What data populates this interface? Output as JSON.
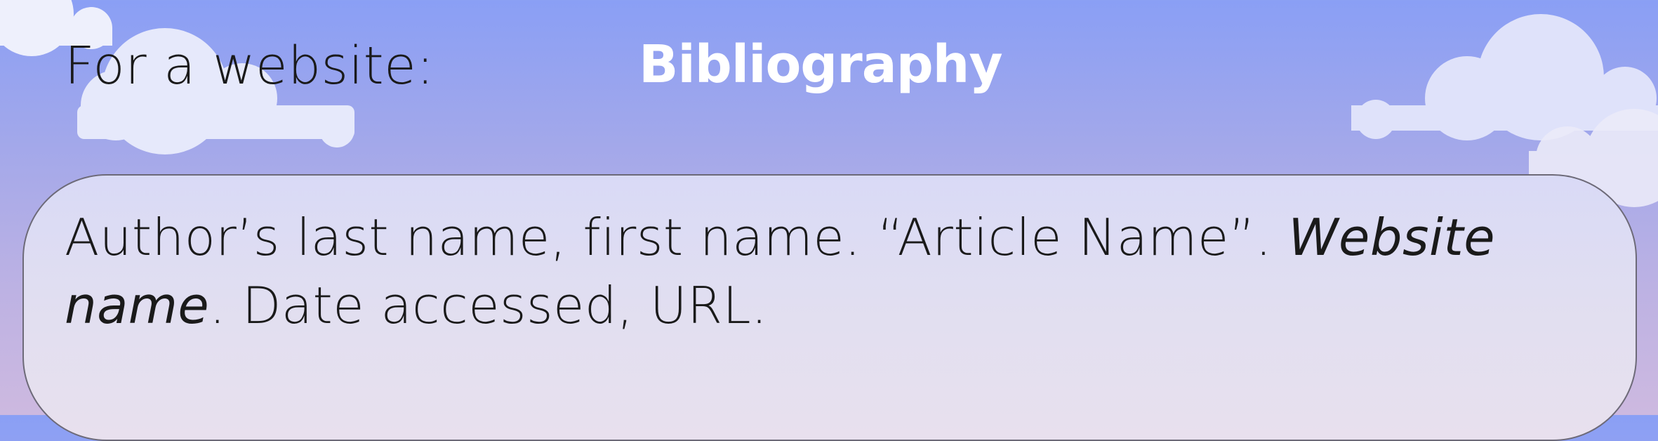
{
  "section_label": "For a website:",
  "title": "Bibliography",
  "citation": {
    "line1_part1": "Author’s last name, first name. “Article Name”. ",
    "line1_italic": "Website",
    "line2_italic": "name",
    "line2_part2": ". Date accessed, URL."
  },
  "colors": {
    "sky_top": "#8a9ff5",
    "sky_bottom": "#cdb9e0",
    "card_fill": "#dfdef3",
    "card_border": "#6d6a78",
    "title": "#ffffff",
    "text": "#1a1a1a"
  }
}
